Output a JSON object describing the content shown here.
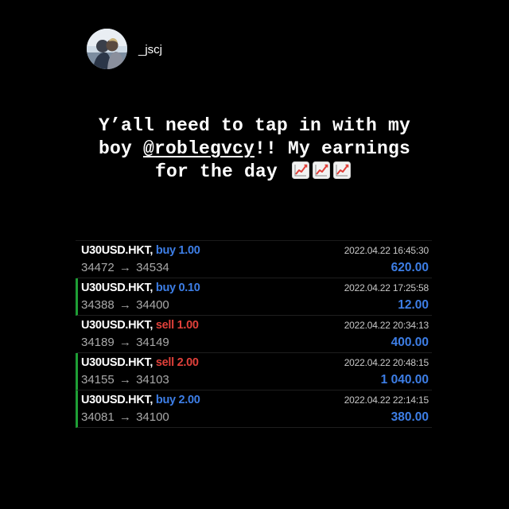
{
  "profile": {
    "username": "_jscj",
    "avatar_icon": "profile-photo"
  },
  "caption": {
    "line1": "Y’all need to tap in with my",
    "line2_prefix": "boy ",
    "mention": "@roblegvcy",
    "line2_suffix": "!! My earnings",
    "line3": "for the day",
    "emoji": [
      "chart-increasing-emoji",
      "chart-increasing-emoji",
      "chart-increasing-emoji"
    ]
  },
  "colors": {
    "buy": "#3d7ee6",
    "sell": "#e0403a",
    "profit": "#3d7ee6",
    "marker": "#1e9e35",
    "background": "#000000"
  },
  "trades": [
    {
      "symbol": "U30USD.HKT,",
      "side": "buy 1.00",
      "side_type": "buy",
      "open_price": "34472",
      "arrow": "→",
      "close_price": "34534",
      "time": "2022.04.22 16:45:30",
      "profit": "620.00",
      "marked": false
    },
    {
      "symbol": "U30USD.HKT,",
      "side": "buy 0.10",
      "side_type": "buy",
      "open_price": "34388",
      "arrow": "→",
      "close_price": "34400",
      "time": "2022.04.22 17:25:58",
      "profit": "12.00",
      "marked": true
    },
    {
      "symbol": "U30USD.HKT,",
      "side": "sell 1.00",
      "side_type": "sell",
      "open_price": "34189",
      "arrow": "→",
      "close_price": "34149",
      "time": "2022.04.22 20:34:13",
      "profit": "400.00",
      "marked": false
    },
    {
      "symbol": "U30USD.HKT,",
      "side": "sell 2.00",
      "side_type": "sell",
      "open_price": "34155",
      "arrow": "→",
      "close_price": "34103",
      "time": "2022.04.22 20:48:15",
      "profit": "1 040.00",
      "marked": true
    },
    {
      "symbol": "U30USD.HKT,",
      "side": "buy 2.00",
      "side_type": "buy",
      "open_price": "34081",
      "arrow": "→",
      "close_price": "34100",
      "time": "2022.04.22 22:14:15",
      "profit": "380.00",
      "marked": true
    }
  ]
}
